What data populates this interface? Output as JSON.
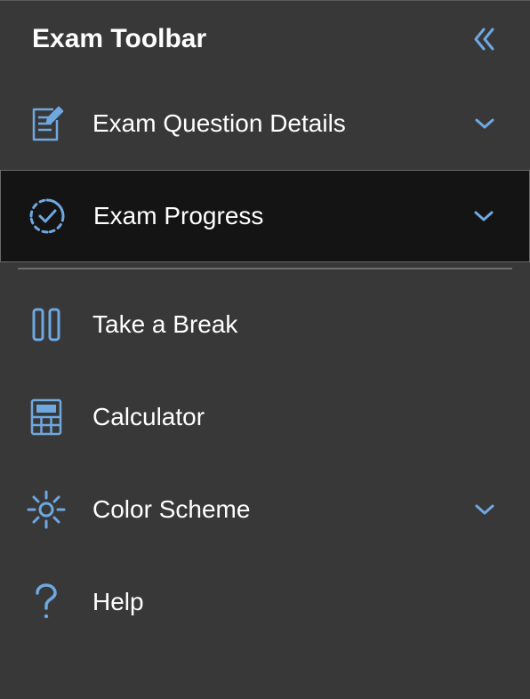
{
  "header": {
    "title": "Exam Toolbar"
  },
  "icons": {
    "collapse": "chevron-double-left-icon",
    "chevron_down": "chevron-down-icon"
  },
  "accent_color": "#6fa8e0",
  "menu": {
    "items": [
      {
        "label": "Exam Question Details",
        "icon": "document-edit-icon",
        "expandable": true,
        "selected": false
      },
      {
        "label": "Exam Progress",
        "icon": "progress-check-icon",
        "expandable": true,
        "selected": true
      },
      {
        "label": "Take a Break",
        "icon": "pause-icon",
        "expandable": false,
        "selected": false
      },
      {
        "label": "Calculator",
        "icon": "calculator-icon",
        "expandable": false,
        "selected": false
      },
      {
        "label": "Color Scheme",
        "icon": "brightness-icon",
        "expandable": true,
        "selected": false
      },
      {
        "label": "Help",
        "icon": "question-icon",
        "expandable": false,
        "selected": false
      }
    ]
  }
}
